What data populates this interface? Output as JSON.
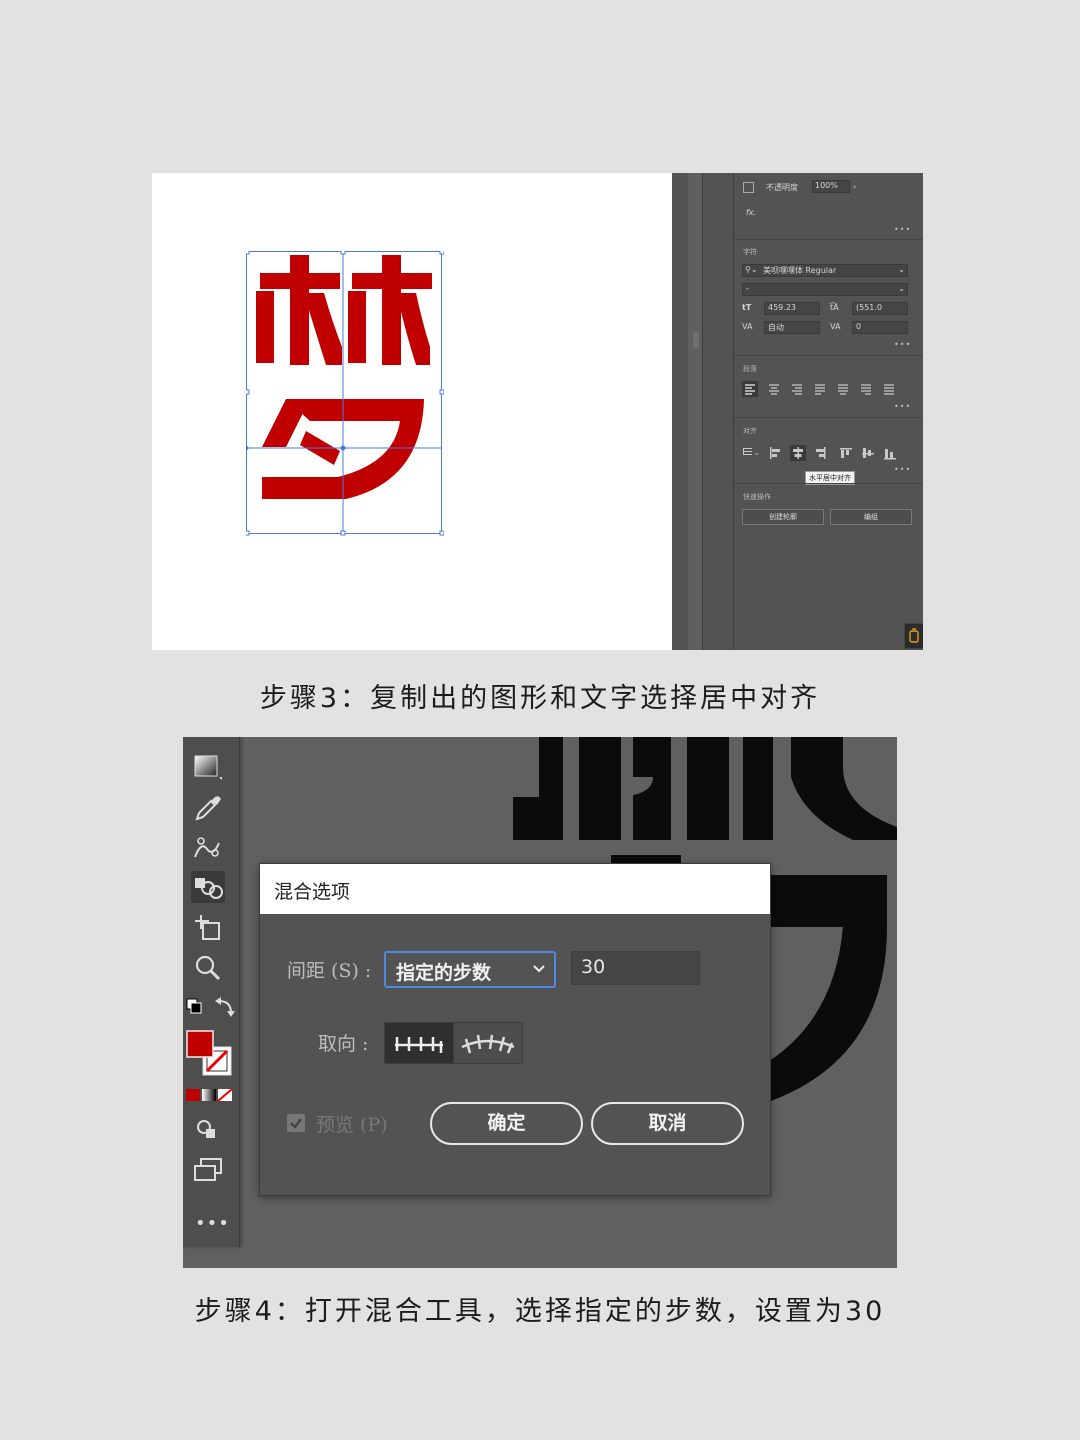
{
  "screenshot1": {
    "panel": {
      "opacity_label": "不透明度",
      "opacity_value": "100%",
      "fx_label": "fx.",
      "character_section": "字符",
      "font_name": "美呗嘿嘿体 Regular",
      "font_style": "-",
      "font_size": "459.23",
      "leading": "(551.0",
      "kerning": "自动",
      "tracking": "0",
      "paragraph_section": "段落",
      "align_section": "对齐",
      "tooltip": "水平居中对齐",
      "quick_actions_section": "快速操作",
      "create_outlines_button": "创建轮廓",
      "group_button": "编组",
      "more": "•••"
    },
    "glyph_color": "#c00000"
  },
  "caption1": "步骤3：复制出的图形和文字选择居中对齐",
  "screenshot2": {
    "dialog": {
      "title": "混合选项",
      "spacing_label": "间距 (S) :",
      "spacing_option": "指定的步数",
      "steps_value": "30",
      "orientation_label": "取向 :",
      "preview_label": "预览 (P)",
      "ok_button": "确定",
      "cancel_button": "取消"
    },
    "fill_color": "#c00000",
    "more": "•••"
  },
  "caption2": "步骤4：打开混合工具，选择指定的步数，设置为30"
}
